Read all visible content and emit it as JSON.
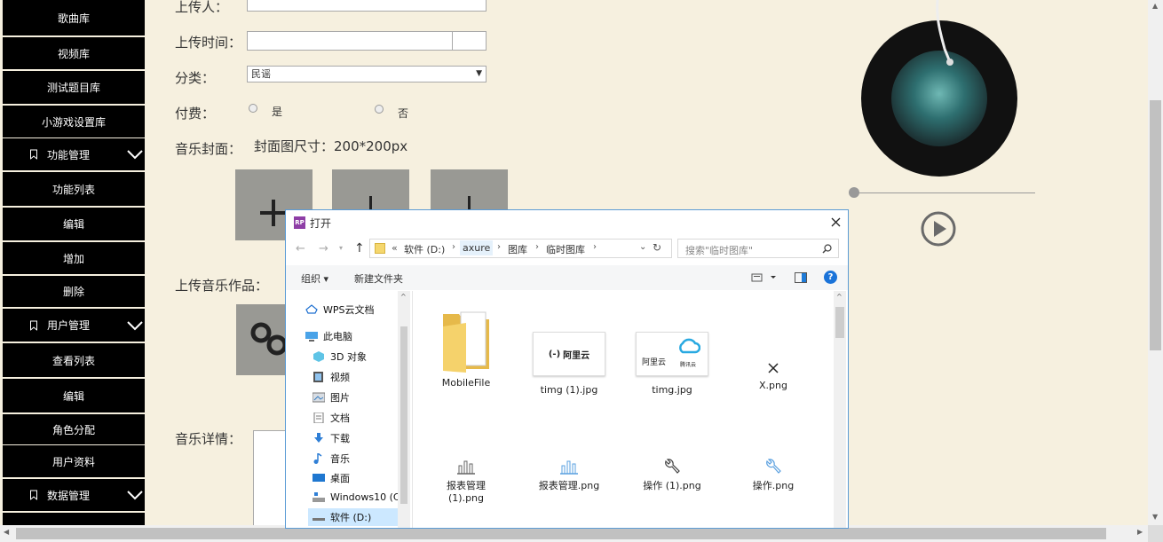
{
  "sidebar": {
    "items": [
      {
        "label": "歌曲库",
        "type": "item"
      },
      {
        "label": "视频库",
        "type": "item"
      },
      {
        "label": "测试题目库",
        "type": "item"
      },
      {
        "label": "小游戏设置库",
        "type": "item"
      },
      {
        "label": "功能管理",
        "type": "menu"
      },
      {
        "label": "功能列表",
        "type": "item"
      },
      {
        "label": "编辑",
        "type": "item"
      },
      {
        "label": "增加",
        "type": "item"
      },
      {
        "label": "删除",
        "type": "item"
      },
      {
        "label": "用户管理",
        "type": "menu"
      },
      {
        "label": "查看列表",
        "type": "item"
      },
      {
        "label": "编辑",
        "type": "item"
      },
      {
        "label": "角色分配",
        "type": "item"
      },
      {
        "label": "用户资料",
        "type": "item"
      },
      {
        "label": "数据管理",
        "type": "menu"
      }
    ]
  },
  "form": {
    "uploader_label": "上传人：",
    "upload_time_label": "上传时间：",
    "category_label": "分类：",
    "category_value": "民谣",
    "paid_label": "付费：",
    "paid_yes": "是",
    "paid_no": "否",
    "cover_label": "音乐封面：",
    "cover_size_hint": "封面图尺寸：200*200px",
    "upload_music_label": "上传音乐作品：",
    "music_detail_label": "音乐详情："
  },
  "player": {
    "progress": 0.0
  },
  "dialog": {
    "title": "打开",
    "breadcrumb": [
      "«",
      "软件 (D:)",
      "axure",
      "图库",
      "临时图库"
    ],
    "search_placeholder": "搜索\"临时图库\"",
    "toolbar": {
      "organize": "组织 ▾",
      "new_folder": "新建文件夹"
    },
    "tree": [
      "WPS云文档",
      "此电脑",
      "3D 对象",
      "视频",
      "图片",
      "文档",
      "下载",
      "音乐",
      "桌面",
      "Windows10 (C:",
      "软件 (D:)"
    ],
    "files": [
      {
        "name": "MobileFile",
        "icon": "folder-icon"
      },
      {
        "name": "timg (1).jpg",
        "icon": "aliyun-image-icon",
        "thumb_text": "阿里云"
      },
      {
        "name": "timg.jpg",
        "icon": "aliyun-tencent-image-icon",
        "thumb_text1": "阿里云",
        "thumb_text2": "腾讯云"
      },
      {
        "name": "X.png",
        "icon": "x-image-icon"
      },
      {
        "name": "报表管理\n(1).png",
        "icon": "bar-chart-icon"
      },
      {
        "name": "报表管理.png",
        "icon": "bar-chart-icon"
      },
      {
        "name": "操作 (1).png",
        "icon": "wrench-icon"
      },
      {
        "name": "操作.png",
        "icon": "wrench-icon"
      }
    ]
  }
}
